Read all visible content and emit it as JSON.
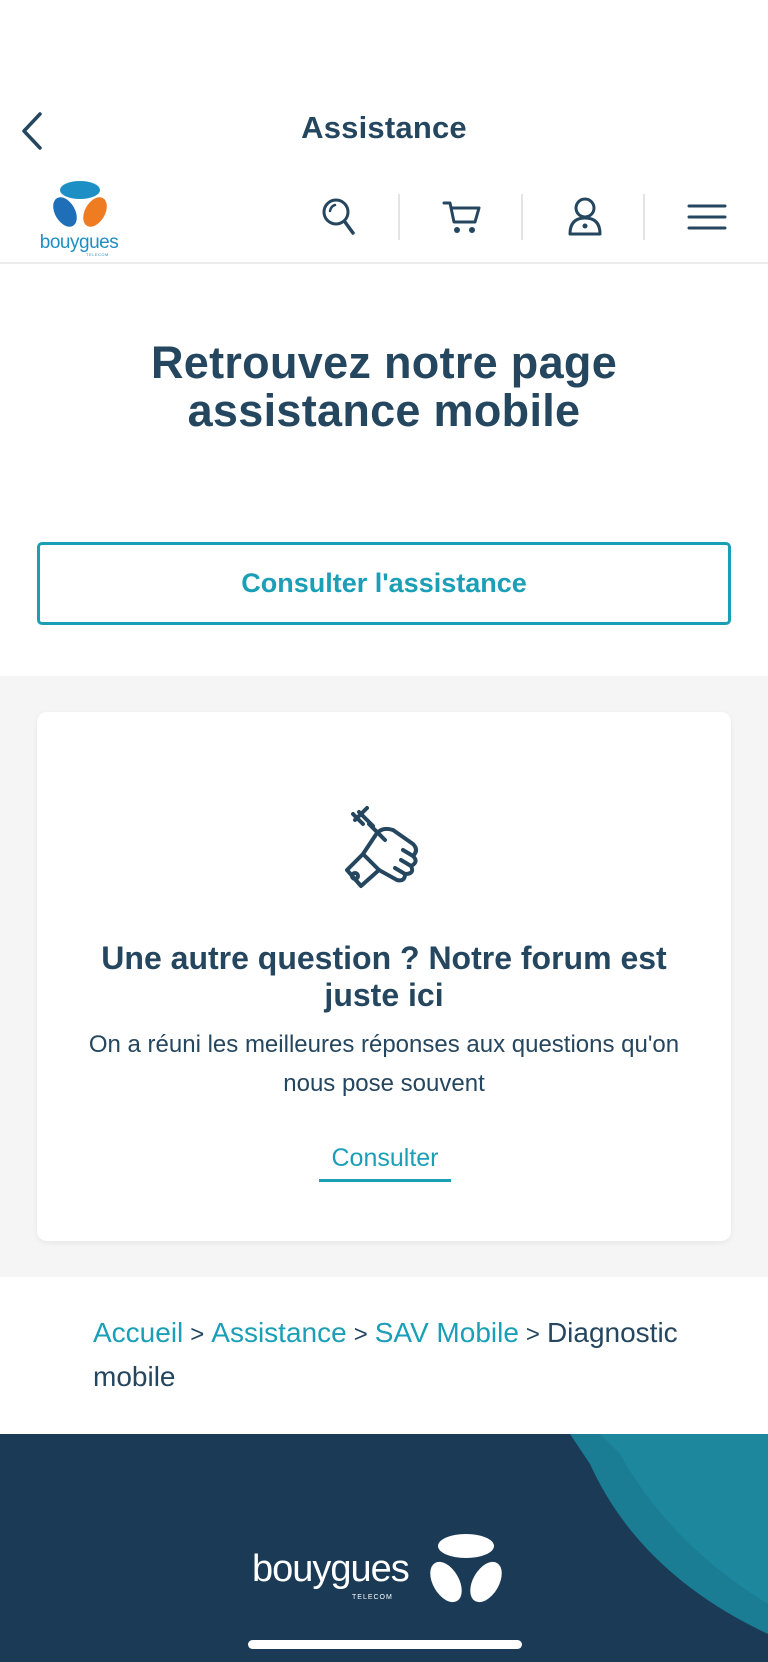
{
  "topbar": {
    "title": "Assistance"
  },
  "header": {
    "logo_text": "bouygues",
    "logo_sub": "TELECOM",
    "icons": [
      "search-icon",
      "cart-icon",
      "user-icon",
      "menu-icon"
    ]
  },
  "hero": {
    "title": "Retrouvez notre page assistance mobile",
    "button_label": "Consulter l'assistance"
  },
  "forum_card": {
    "icon": "repair-hand-icon",
    "title": "Une autre question ? Notre forum est juste ici",
    "text": "On a réuni les meilleures réponses aux questions qu'on nous pose souvent",
    "link_label": "Consulter"
  },
  "breadcrumb": {
    "items": [
      {
        "label": "Accueil",
        "link": true
      },
      {
        "label": "Assistance",
        "link": true
      },
      {
        "label": "SAV Mobile",
        "link": true
      },
      {
        "label": "Diagnostic mobile",
        "link": false
      }
    ]
  },
  "footer": {
    "logo_text": "bouygues",
    "logo_sub": "TELECOM"
  },
  "colors": {
    "navy": "#25465f",
    "teal": "#1a9fb7",
    "logo_blue": "#1e8fc4",
    "logo_orange": "#f07c21",
    "footer_bg": "#1b3a56",
    "band_bg": "#f5f5f5"
  }
}
